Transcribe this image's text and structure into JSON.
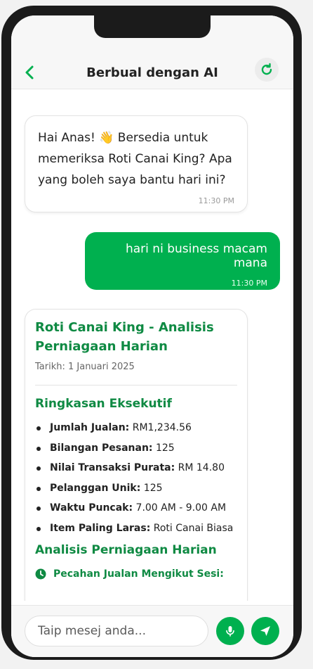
{
  "header": {
    "title": "Berbual dengan AI",
    "back_icon": "chevron-left-icon",
    "refresh_icon": "refresh-icon"
  },
  "messages": {
    "greeting": {
      "text": "Hai Anas! 👋 Bersedia untuk memeriksa Roti Canai King? Apa yang boleh saya bantu hari ini?",
      "time": "11:30 PM"
    },
    "user": {
      "text": "hari ni business macam mana",
      "time": "11:30 PM"
    },
    "report": {
      "title": "Roti Canai King - Analisis Perniagaan Harian",
      "date": "Tarikh: 1 Januari 2025",
      "summary_heading": "Ringkasan Eksekutif",
      "summary": [
        {
          "label": "Jumlah Jualan:",
          "value": " RM1,234.56"
        },
        {
          "label": "Bilangan Pesanan:",
          "value": " 125"
        },
        {
          "label": "Nilai Transaksi Purata:",
          "value": " RM 14.80"
        },
        {
          "label": "Pelanggan Unik:",
          "value": " 125"
        },
        {
          "label": "Waktu Puncak:",
          "value": " 7.00 AM - 9.00 AM"
        },
        {
          "label": "Item Paling Laras:",
          "value": " Roti Canai Biasa"
        }
      ],
      "analysis_heading": "Analisis Perniagaan Harian",
      "sub_heading": "Pecahan Jualan Mengikut Sesi:"
    }
  },
  "input": {
    "placeholder": "Taip mesej anda..."
  },
  "colors": {
    "accent": "#00b04f",
    "heading_green": "#0f8a43"
  }
}
